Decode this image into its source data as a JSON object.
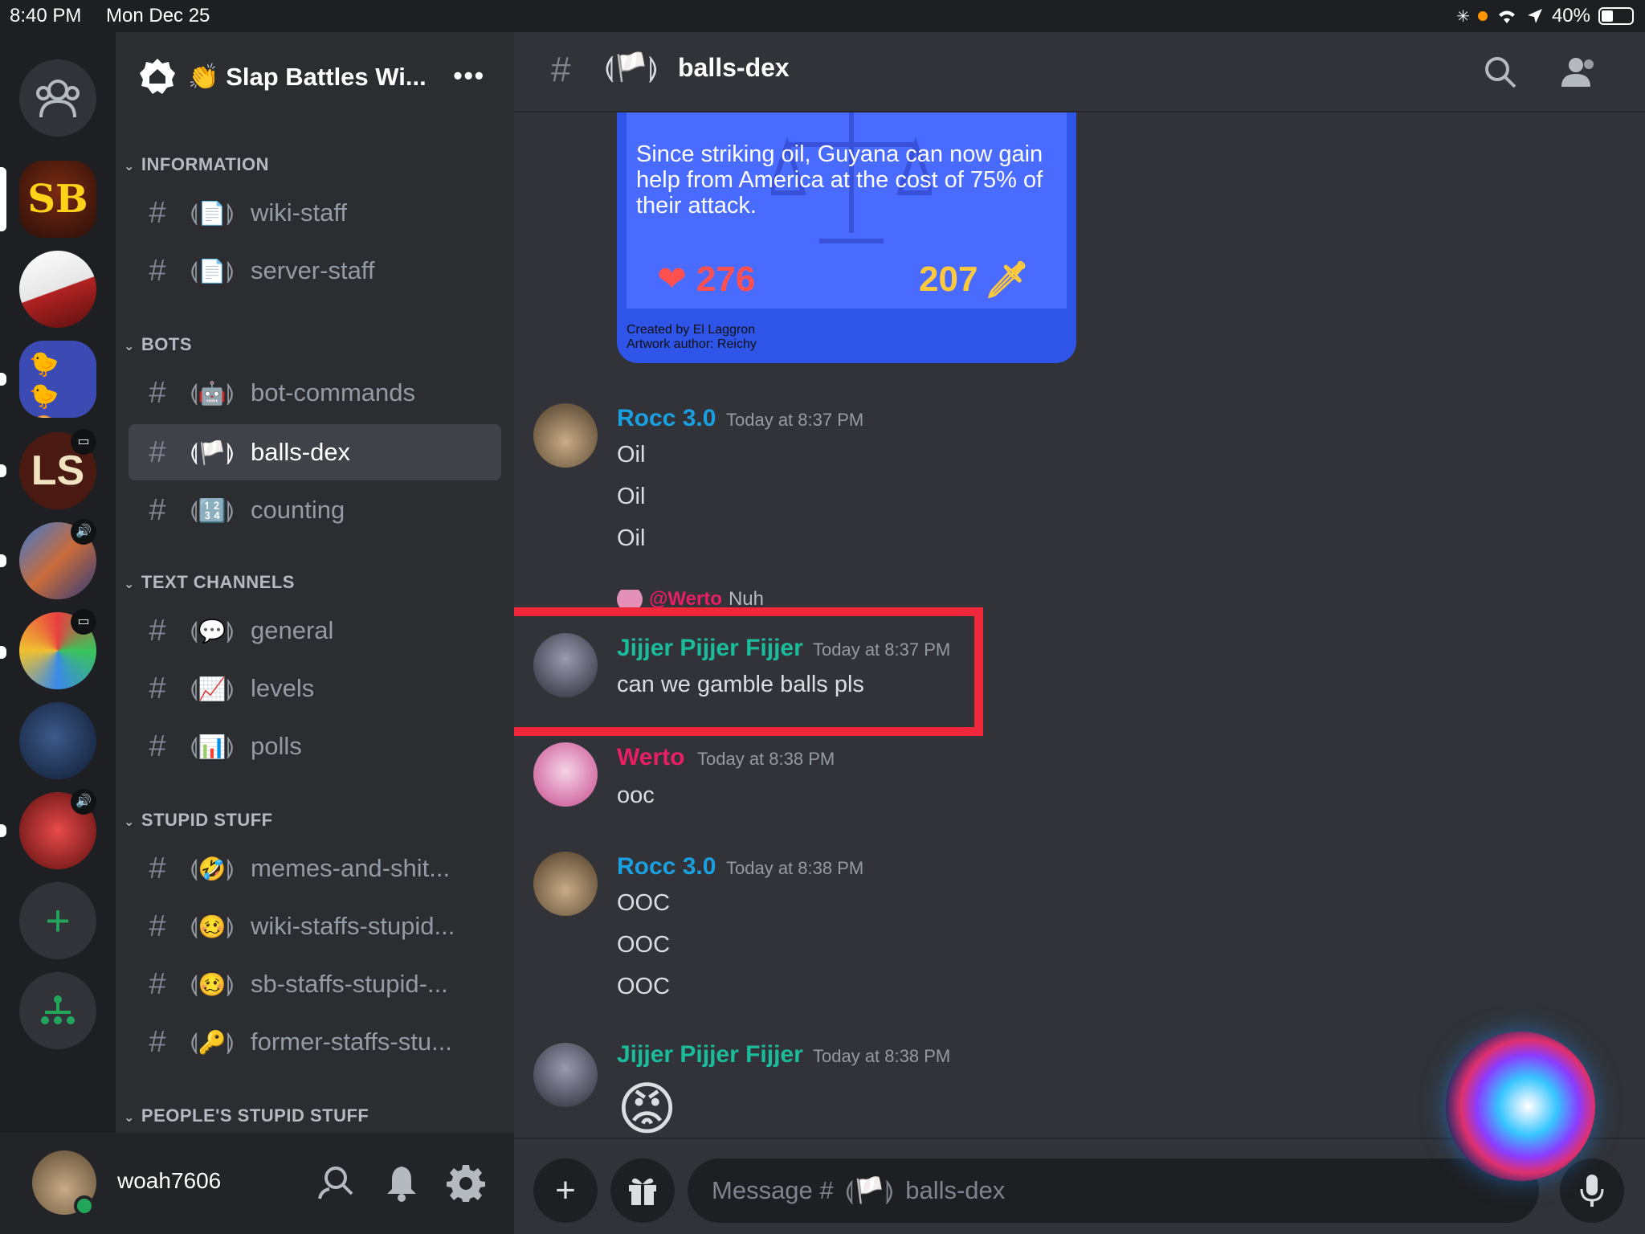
{
  "status_bar": {
    "time": "8:40 PM",
    "date": "Mon Dec 25",
    "battery": "40%"
  },
  "server": {
    "name": "👏 Slap Battles Wi...",
    "more": "•••"
  },
  "categories": {
    "information": "INFORMATION",
    "bots": "BOTS",
    "text_channels": "TEXT CHANNELS",
    "stupid_stuff": "STUPID STUFF",
    "peoples_stupid_stuff": "PEOPLE'S STUPID STUFF"
  },
  "channels": [
    {
      "emoji": "📄",
      "name": "wiki-staff"
    },
    {
      "emoji": "📄",
      "name": "server-staff"
    },
    {
      "emoji": "🤖",
      "name": "bot-commands"
    },
    {
      "emoji": "🏳️",
      "name": "balls-dex"
    },
    {
      "emoji": "🔢",
      "name": "counting"
    },
    {
      "emoji": "💬",
      "name": "general"
    },
    {
      "emoji": "📈",
      "name": "levels"
    },
    {
      "emoji": "📊",
      "name": "polls"
    },
    {
      "emoji": "🤣",
      "name": "memes-and-shit..."
    },
    {
      "emoji": "🥴",
      "name": "wiki-staffs-stupid..."
    },
    {
      "emoji": "🥴",
      "name": "sb-staffs-stupid-..."
    },
    {
      "emoji": "🔑",
      "name": "former-staffs-stu..."
    }
  ],
  "user": {
    "name": "woah7606"
  },
  "header": {
    "hash": "#",
    "emoji": "🏳️",
    "title": "balls-dex"
  },
  "embed": {
    "text": "Since striking oil, Guyana can now gain help from America at the cost of 75% of their attack.",
    "hp": "276",
    "attack": "207",
    "created_by": "Created by El Laggron",
    "artwork_author": "Artwork author: Reichy"
  },
  "messages": [
    {
      "author": "Rocc 3.0",
      "timestamp": "Today at 8:37 PM",
      "lines": [
        "Oil",
        "Oil",
        "Oil"
      ]
    },
    {
      "reply_mention": "@Werto",
      "reply_text": "Nuh",
      "author": "Jijjer Pijjer Fijjer",
      "timestamp": "Today at 8:37 PM",
      "lines": [
        "can we gamble balls pls"
      ]
    },
    {
      "author": "Werto",
      "timestamp": "Today at 8:38 PM",
      "lines": [
        "ooc"
      ]
    },
    {
      "author": "Rocc 3.0",
      "timestamp": "Today at 8:38 PM",
      "lines": [
        "OOC",
        "OOC",
        "OOC"
      ]
    },
    {
      "author": "Jijjer Pijjer Fijjer",
      "timestamp": "Today at 8:38 PM",
      "lines": [
        "😡"
      ]
    }
  ],
  "input": {
    "placeholder": "Message #",
    "emoji": "🏳️",
    "channel": "balls-dex"
  },
  "colors": {
    "highlight": "#f0263a",
    "teal_author": "#1abc9c",
    "blue_author": "#1a9fe0",
    "pink_author": "#e91e63",
    "embed_blue": "#2f54e8"
  }
}
